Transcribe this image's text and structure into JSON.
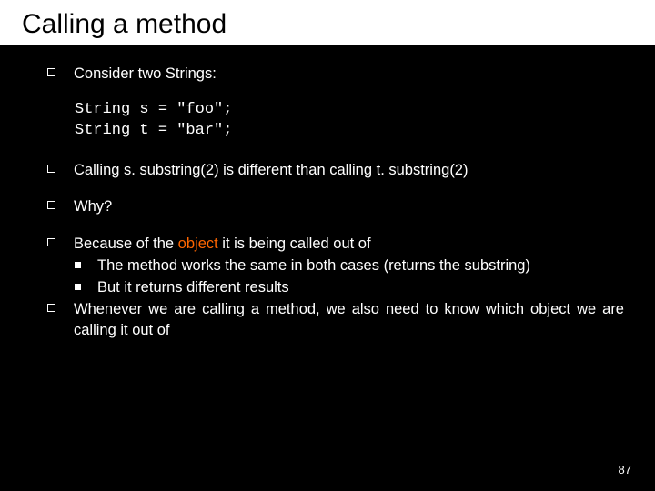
{
  "slide": {
    "title": "Calling a method",
    "bullets": {
      "b1": "Consider two Strings:",
      "code1": "String s = \"foo\";",
      "code2": "String t = \"bar\";",
      "b2": "Calling s. substring(2) is different than calling t. substring(2)",
      "b3": "Why?",
      "b4_pre": "Because of the ",
      "b4_hl": "object",
      "b4_post": " it is being called out of",
      "b4_sub1": "The method works the same in both cases (returns the substring)",
      "b4_sub2": "But it returns different results",
      "b5": "Whenever we are calling a method, we also need to know which object we are calling it out of"
    },
    "page_number": "87"
  }
}
